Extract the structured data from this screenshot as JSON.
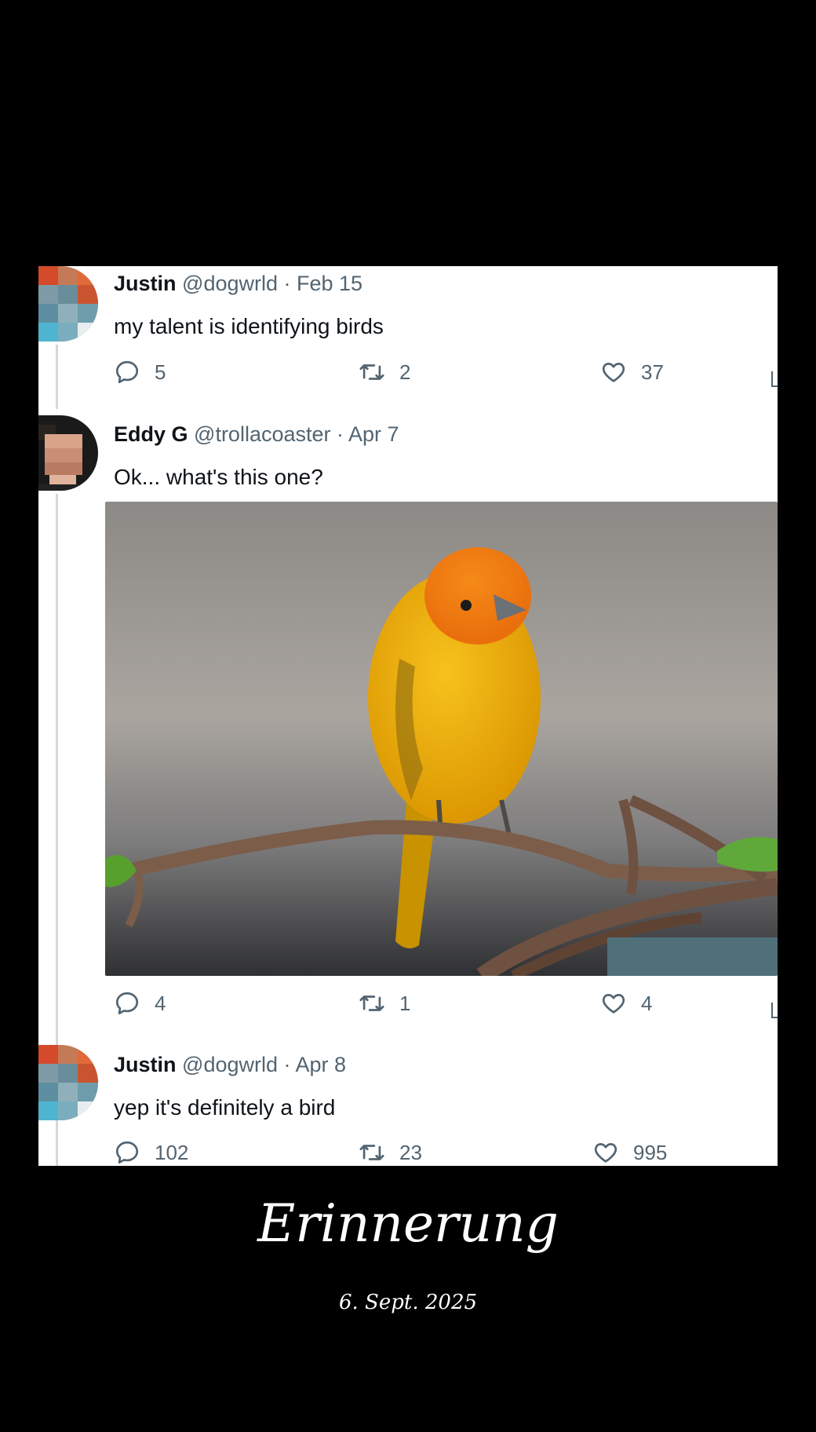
{
  "tweets": [
    {
      "name": "Justin",
      "handle": "@dogwrld",
      "date": "· Feb 15",
      "text": "my talent is identifying birds",
      "replies": "5",
      "retweets": "2",
      "likes": "37"
    },
    {
      "name": "Eddy G",
      "handle": "@trollacoaster",
      "date": "· Apr 7",
      "text": "Ok... what's this one?",
      "replies": "4",
      "retweets": "1",
      "likes": "4"
    },
    {
      "name": "Justin",
      "handle": "@dogwrld",
      "date": "· Apr 8",
      "text": "yep it's definitely a bird",
      "replies": "102",
      "retweets": "23",
      "likes": "995"
    }
  ],
  "caption": {
    "title": "Erinnerung",
    "date": "6. Sept. 2025"
  },
  "icons": [
    "reply-icon",
    "retweet-icon",
    "like-icon"
  ],
  "colors": {
    "background": "#000000",
    "card": "#ffffff",
    "primary_text": "#0f1419",
    "secondary_text": "#536471",
    "bird": "#f2b00c",
    "bird_head": "#f07a10"
  }
}
